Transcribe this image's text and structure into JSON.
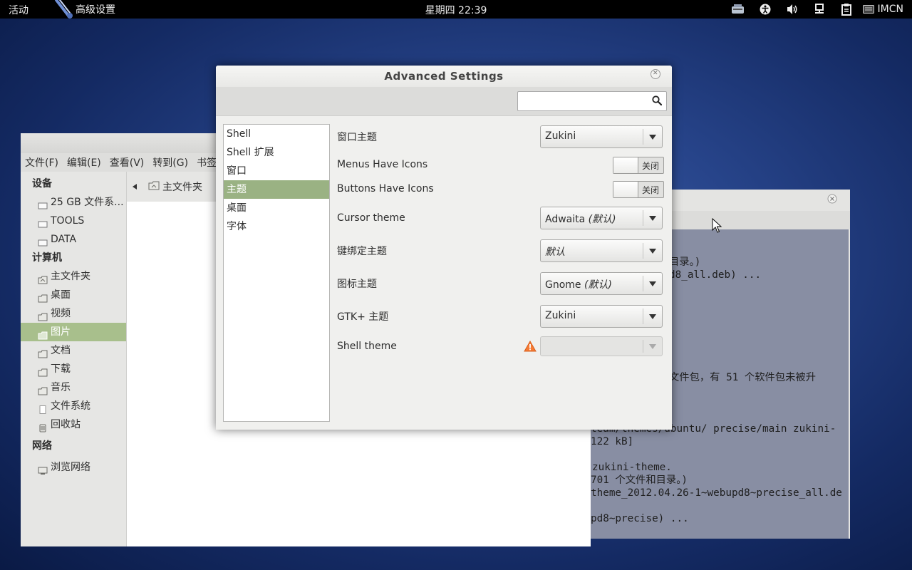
{
  "topbar": {
    "activities": "活动",
    "app_name": "高级设置",
    "clock": "星期四 22:39",
    "input_method": "IMCN"
  },
  "file_manager": {
    "menu": [
      "文件(F)",
      "编辑(E)",
      "查看(V)",
      "转到(G)",
      "书签"
    ],
    "path_current": "主文件夹",
    "sidebar": {
      "devices_header": "设备",
      "devices": [
        "25 GB 文件系...",
        "TOOLS",
        "DATA"
      ],
      "computer_header": "计算机",
      "computer": [
        "主文件夹",
        "桌面",
        "视频",
        "图片",
        "文档",
        "下载",
        "音乐",
        "文件系统",
        "回收站"
      ],
      "selected": "图片",
      "network_header": "网络",
      "network": [
        "浏览网络"
      ]
    }
  },
  "terminal": {
    "lines": [
      "目录。)",
      "d8_all.deb) ...",
      "文件包，有 51 个软件包未被升",
      "team/themes/ubuntu/ precise/main zukini-",
      "122 kB]",
      "zukini-theme.",
      "701 个文件和目录。)",
      "theme_2012.04.26-1~webupd8~precise_all.de",
      "pd8~precise) ..."
    ]
  },
  "advanced_settings": {
    "title": "Advanced Settings",
    "search_placeholder": "",
    "categories": [
      "Shell",
      "Shell 扩展",
      "窗口",
      "主题",
      "桌面",
      "字体"
    ],
    "selected_category": "主题",
    "rows": {
      "window_theme": {
        "label": "窗口主题",
        "value": "Zukini"
      },
      "menus_icons": {
        "label": "Menus Have Icons",
        "state": "关闭"
      },
      "buttons_icons": {
        "label": "Buttons Have Icons",
        "state": "关闭"
      },
      "cursor_theme": {
        "label": "Cursor theme",
        "value": "Adwaita",
        "default_tag": "(默认)"
      },
      "keybinding_theme": {
        "label": "键绑定主题",
        "value": "",
        "default_tag": "默认"
      },
      "icon_theme": {
        "label": "图标主题",
        "value": "Gnome",
        "default_tag": "(默认)"
      },
      "gtk_theme": {
        "label": "GTK+ 主题",
        "value": "Zukini"
      },
      "shell_theme": {
        "label": "Shell theme",
        "value": ""
      }
    }
  },
  "colors": {
    "selection_green": "#9ab283",
    "warning_orange": "#f57a33"
  },
  "icons": {
    "close": "close-icon",
    "search": "search-icon",
    "warning": "warning-icon",
    "folder": "folder-icon"
  }
}
